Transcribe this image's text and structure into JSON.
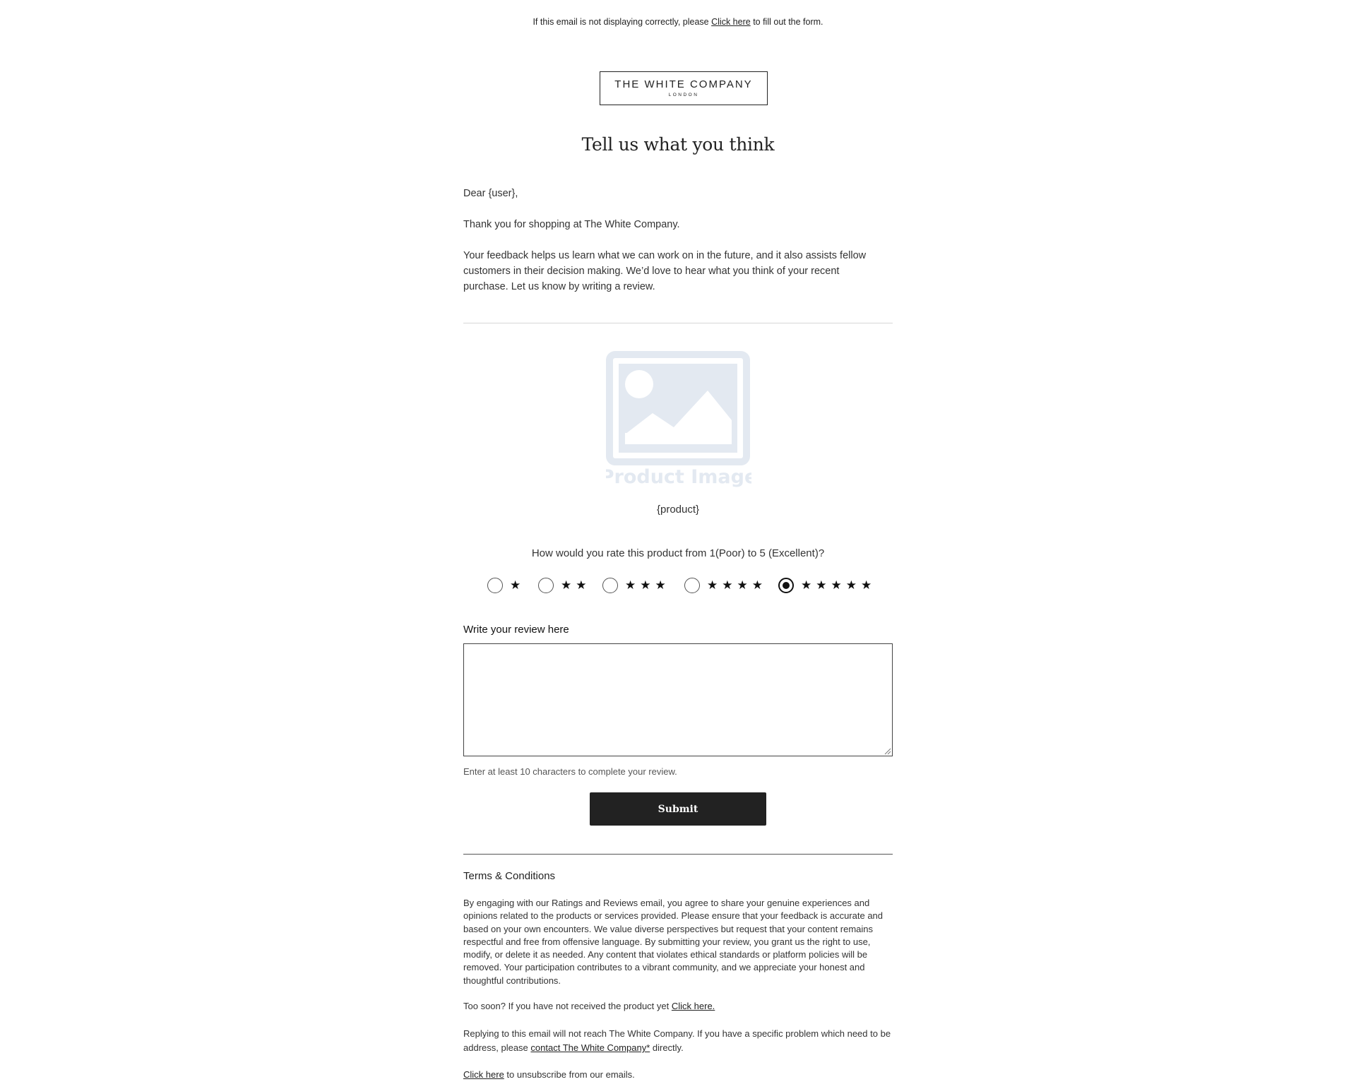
{
  "top_notice": {
    "before": "If this email is not displaying correctly, please",
    "link": "Click here",
    "after": "to fill out the form."
  },
  "brand": {
    "name": "THE WHITE COMPANY",
    "sub": "LONDON"
  },
  "heading": "Tell us what you think",
  "greeting": "Dear {user},",
  "thanks": "Thank you for shopping at The White Company.",
  "intro": "Your feedback helps us learn what we can work on in the future, and it also assists fellow customers in their decision making. We’d love to hear what you think of your recent purchase. Let us know by writing a review.",
  "product": {
    "image_label": "Product Image",
    "name": "{product}",
    "image_color": "#e3e9f1"
  },
  "rating": {
    "question": "How would you rate this product from 1(Poor) to 5 (Excellent)?",
    "options": [
      {
        "stars": "★",
        "selected": false
      },
      {
        "stars": "★★",
        "selected": false
      },
      {
        "stars": "★★★",
        "selected": false
      },
      {
        "stars": "★★★★",
        "selected": false
      },
      {
        "stars": "★★★★★",
        "selected": true
      }
    ],
    "selected_value": 5
  },
  "review": {
    "label": "Write your review here",
    "value": "",
    "hint": "Enter at least 10 characters to complete your review."
  },
  "submit_label": "Submit",
  "terms": {
    "title": "Terms & Conditions",
    "body": "By engaging with our Ratings and Reviews email, you agree to share your genuine experiences and opinions related to the products or services provided. Please ensure that your feedback is accurate and based on your own encounters. We value diverse perspectives but request that your content remains respectful and free from offensive language. By submitting your review, you grant us the right to use, modify, or delete it as needed. Any content that violates ethical standards or platform policies will be removed. Your participation contributes to a vibrant community, and we appreciate your honest and thoughtful contributions.",
    "too_soon_text": "Too soon? If you have not received the product yet",
    "too_soon_link": "Click here.",
    "reply_text": "Replying to this email will not reach The White Company. If you have a specific problem which need to be address, please",
    "reply_link": "contact The White Company*",
    "reply_after": "directly.",
    "unsubscribe_link": "Click here",
    "unsubscribe_text": "to unsubscribe from our emails."
  },
  "colors": {
    "button": "#222222",
    "text": "#333333"
  }
}
